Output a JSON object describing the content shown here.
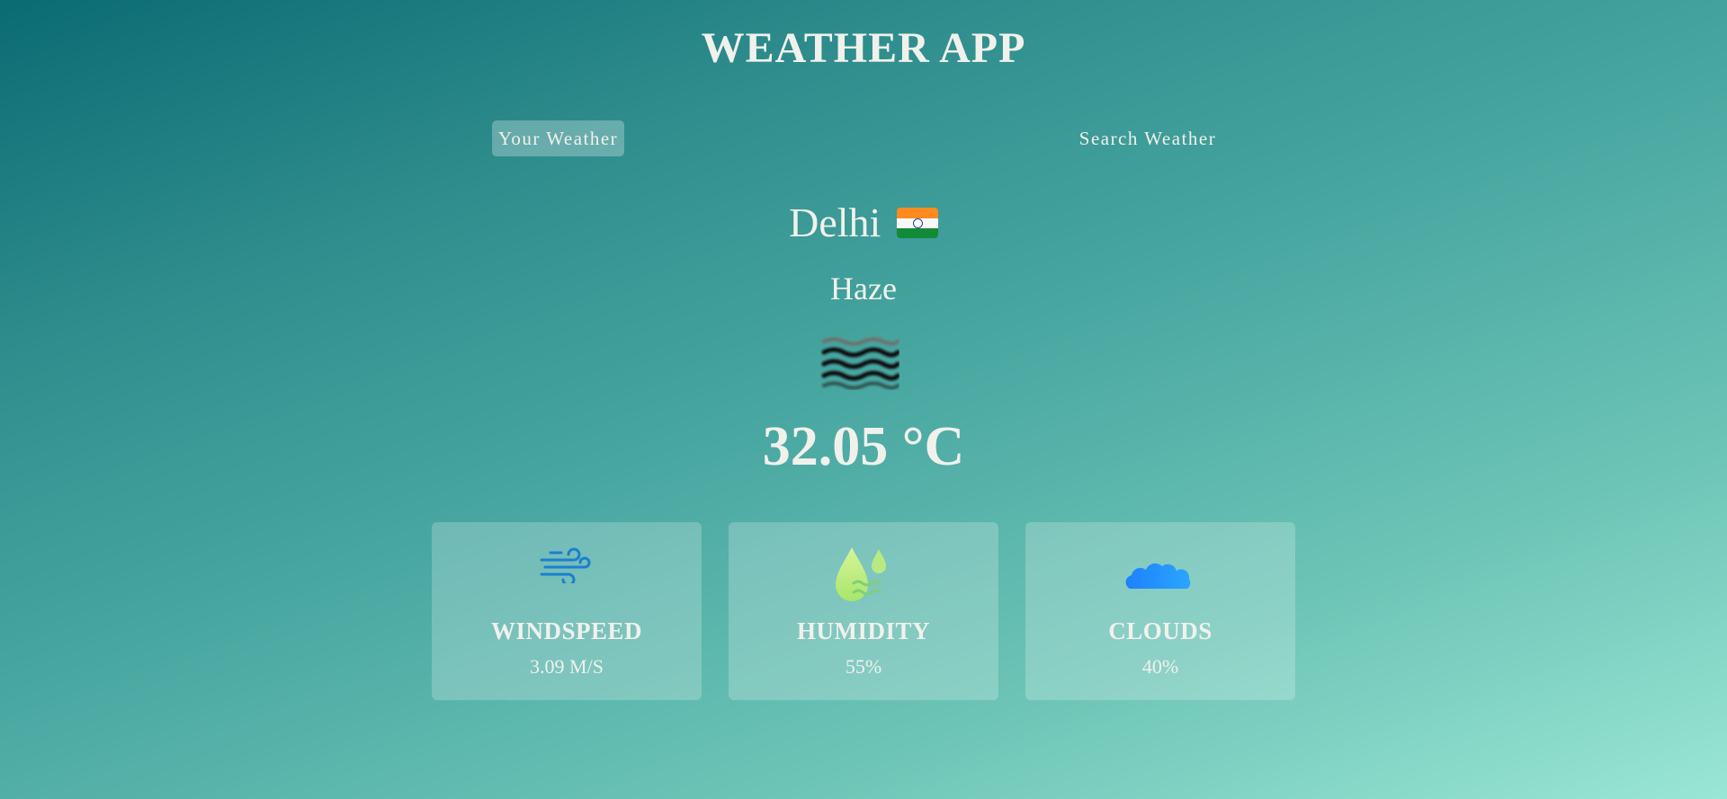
{
  "app": {
    "title": "WEATHER APP"
  },
  "tabs": [
    {
      "label": "Your Weather",
      "active": true
    },
    {
      "label": "Search Weather",
      "active": false
    }
  ],
  "location": {
    "city": "Delhi",
    "flag_icon": "india-flag-icon"
  },
  "weather": {
    "description": "Haze",
    "icon": "haze-icon",
    "temperature": "32.05 °C"
  },
  "stats": {
    "windspeed": {
      "label": "WINDSPEED",
      "value": "3.09 M/S",
      "icon": "wind-icon"
    },
    "humidity": {
      "label": "HUMIDITY",
      "value": "55%",
      "icon": "humidity-drops-icon"
    },
    "clouds": {
      "label": "CLOUDS",
      "value": "40%",
      "icon": "cloud-icon"
    }
  },
  "colors": {
    "gradient_start": "#0b6b73",
    "gradient_end": "#9ae6d4",
    "text": "#f1f1ec",
    "wind_icon": "#1b7fd1",
    "humidity_icon": "#c8f27a",
    "cloud_icon": "#1e90ff"
  }
}
